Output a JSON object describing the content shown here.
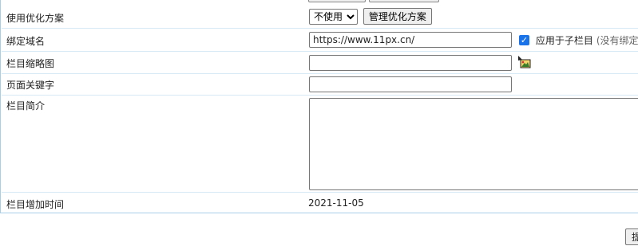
{
  "rows": {
    "optimize": {
      "label": "使用优化方案",
      "select_value": "不使用",
      "button": "管理优化方案"
    },
    "domain": {
      "label": "绑定域名",
      "value": "https://www.11px.cn/",
      "checkbox_label": "应用于子栏目",
      "note": "(没有绑定"
    },
    "thumb": {
      "label": "栏目缩略图",
      "value": ""
    },
    "keywords": {
      "label": "页面关键字",
      "value": ""
    },
    "intro": {
      "label": "栏目简介",
      "value": ""
    },
    "date": {
      "label": "栏目增加时间",
      "value": "2021-11-05"
    }
  },
  "footer": {
    "submit_label": "提"
  },
  "colors": {
    "border": "#a9cfe8",
    "row_line": "#d7e9f5",
    "checkbox": "#1a73e8"
  },
  "icons": {
    "thumb_picker": "image-picker-icon",
    "checkbox": "check-icon"
  }
}
